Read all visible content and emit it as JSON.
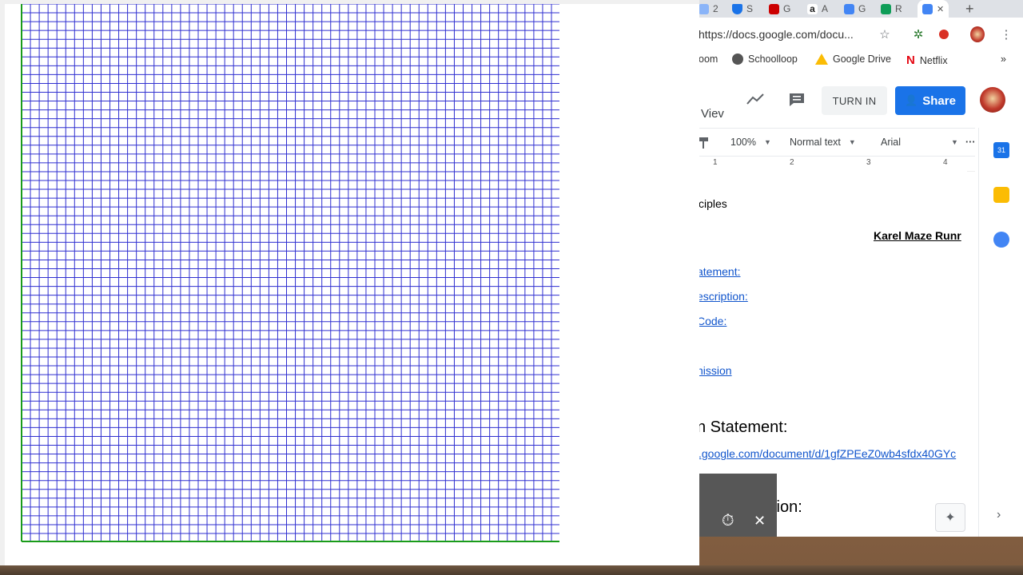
{
  "browser": {
    "tabs": [
      {
        "label": "2",
        "icon": "generic-tab-icon",
        "color": "#8ab4f8"
      },
      {
        "label": "S",
        "icon": "shield-tab-icon",
        "color": "#1a73e8"
      },
      {
        "label": "G",
        "icon": "cvs-tab-icon",
        "color": "#cc0000"
      },
      {
        "label": "A",
        "icon": "amazon-tab-icon",
        "color": "#222222"
      },
      {
        "label": "G",
        "icon": "docs-tab-icon",
        "color": "#4285f4"
      },
      {
        "label": "R",
        "icon": "classroom-tab-icon",
        "color": "#0f9d58"
      },
      {
        "label": "",
        "icon": "docs-active-tab-icon",
        "color": "#4285f4"
      }
    ],
    "new_tab_glyph": "+",
    "close_tab_glyph": "✕",
    "url": "https://docs.google.com/docu...",
    "bookmarks": [
      {
        "label": "oom",
        "icon": "classroom-icon"
      },
      {
        "label": "Schoolloop",
        "icon": "globe-icon"
      },
      {
        "label": "Google Drive",
        "icon": "google-drive-icon"
      },
      {
        "label": "Netflix",
        "icon": "netflix-icon"
      }
    ],
    "bookmarks_more": "»"
  },
  "docs": {
    "view_menu": "Viev",
    "turn_in_label": "TURN IN",
    "share_label": "Share",
    "zoom": "100%",
    "style": "Normal text",
    "font": "Arial",
    "more": "···",
    "ruler_marks": [
      "1",
      "2",
      "3",
      "4"
    ],
    "lines": [
      {
        "text": "ciples",
        "style": "plain"
      },
      {
        "text": "Karel Maze Runr",
        "style": "bold-underline"
      },
      {
        "text": "atement:",
        "style": "link"
      },
      {
        "text": "escription:",
        "style": "link"
      },
      {
        "text": "Code:",
        "style": "link"
      },
      {
        "text": "nission",
        "style": "link"
      },
      {
        "text": "n Statement:",
        "style": "heading"
      },
      {
        "text": ".google.com/document/d/1gfZPEeZ0wb4sfdx40GYc",
        "style": "link"
      },
      {
        "text": "tion:",
        "style": "heading"
      }
    ]
  },
  "overlay": {
    "timer_icon": "timer-icon",
    "close_glyph": "✕"
  },
  "colors": {
    "grid_line": "#2f2fd0",
    "grid_border_green": "#1a9c1a",
    "share_blue": "#1a73e8",
    "link_blue": "#1155cc"
  }
}
